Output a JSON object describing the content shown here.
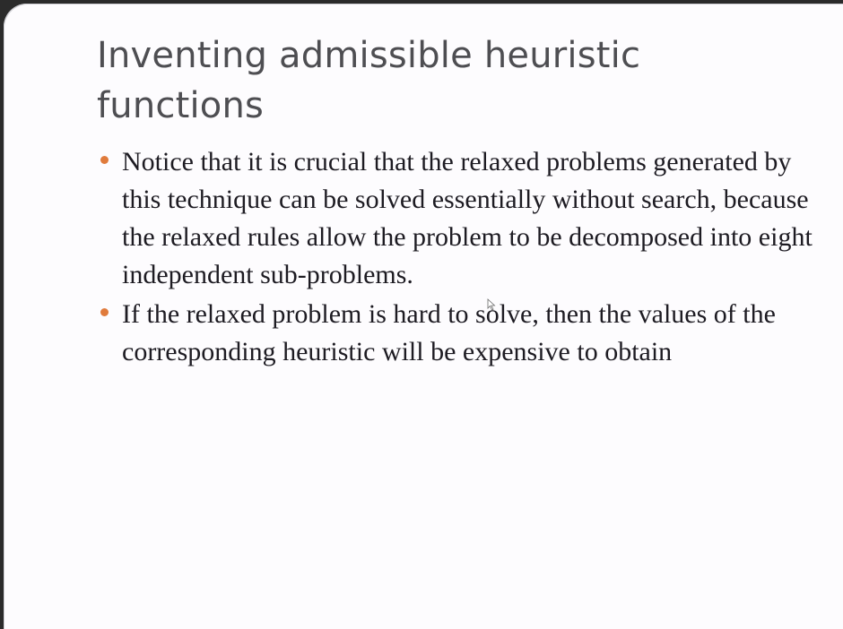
{
  "slide": {
    "title": "Inventing admissible heuristic functions",
    "bullets": [
      {
        "text": "Notice that it is crucial that the relaxed problems generated by this technique can be solved essentially without search, because the relaxed rules allow the problem to be decomposed into eight independent sub-problems."
      },
      {
        "text": "If the relaxed problem is hard to solve, then the values of the corresponding heuristic will be expensive to obtain"
      }
    ]
  },
  "colors": {
    "slide_background": "#fdfcfe",
    "title_text": "#4e4e52",
    "body_text": "#1d1b22",
    "bullet_accent": "#e07b3c"
  },
  "icons": {
    "cursor": "mouse-pointer-icon",
    "bullet": "round-bullet-icon"
  }
}
